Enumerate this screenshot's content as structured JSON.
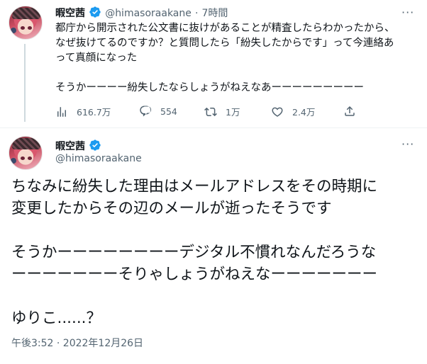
{
  "reply_tweet": {
    "display_name": "暇空茜",
    "handle": "@himasoraakane",
    "separator": "·",
    "time_ago": "7時間",
    "text_lines": [
      "都庁から開示された公文書に抜けがあることが精査したらわかったから、",
      "なぜ抜けてるのですか？と質問したら「紛失したからです」って今連絡あ",
      "って真顔になった",
      "",
      "そうかーーーー紛失したならしょうがねえなあーーーーーーーーー"
    ],
    "stats": {
      "views": "616.7万",
      "replies": "554",
      "retweets": "1万",
      "likes": "2.4万"
    }
  },
  "main_tweet": {
    "display_name": "暇空茜",
    "handle": "@himasoraakane",
    "paragraphs": [
      "ちなみに紛失した理由はメールアドレスをその時期に\n変更したからその辺のメールが逝ったそうです",
      "そうかーーーーーーーーデジタル不慣れなんだろうな\nーーーーーーーそりゃしょうがねえなーーーーーーー",
      "ゆりこ......？"
    ],
    "timestamp": "午後3:52 · 2022年12月26日"
  },
  "icons": {
    "verified": "verified-badge-icon",
    "more": "more-options-icon",
    "views": "views-chart-icon",
    "reply": "reply-icon",
    "retweet": "retweet-icon",
    "like": "like-icon",
    "share": "share-icon"
  },
  "colors": {
    "verified": "#1d9bf0",
    "text": "#0f1419",
    "muted": "#536471",
    "thread_line": "#cfd9de"
  }
}
